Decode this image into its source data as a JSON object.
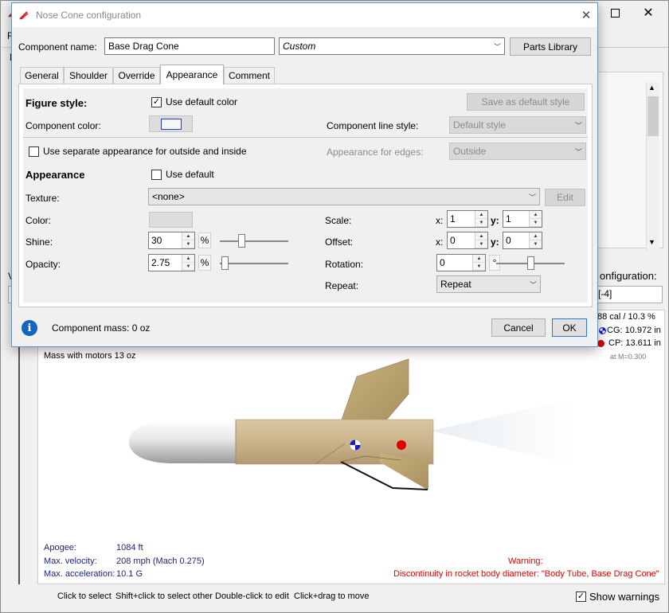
{
  "background": {
    "config_label_partial": "onfiguration:",
    "config_value_partial": "[-4]",
    "left_label_partial": "V",
    "side_tab_partial": "F",
    "menu_partial": "F",
    "stats": {
      "stability": "88 cal / 10.3 %",
      "cg": "CG: 10.972 in",
      "cp": "CP: 13.611 in",
      "mach_note": "at M=0.300"
    },
    "mass_with_motors": "Mass with motors 13 oz",
    "flight": {
      "apogee_label": "Apogee:",
      "apogee_value": "1084 ft",
      "velocity_label": "Max. velocity:",
      "velocity_value": "208 mph  (Mach 0.275)",
      "accel_label": "Max. acceleration:",
      "accel_value": "10.1 G"
    },
    "warning_title": "Warning:",
    "warning_text": "Discontinuity in rocket body diameter:  \"Body Tube, Base Drag Cone\"",
    "hints": {
      "select": "Click to select",
      "shift": "Shift+click to select other",
      "double": "Double-click to edit",
      "drag": "Click+drag to move"
    },
    "show_warnings_label": "Show warnings",
    "show_warnings_checked": true
  },
  "dialog": {
    "title": "Nose Cone configuration",
    "component_name_label": "Component name:",
    "component_name_value": "Base Drag Cone",
    "preset_value": "Custom",
    "parts_library_label": "Parts Library",
    "tabs": [
      "General",
      "Shoulder",
      "Override",
      "Appearance",
      "Comment"
    ],
    "active_tab": "Appearance",
    "figure_style_label": "Figure style:",
    "use_default_color_label": "Use default color",
    "use_default_color_checked": true,
    "save_default_style_label": "Save as default style",
    "component_color_label": "Component color:",
    "component_color_value": "#f4f6fb",
    "component_line_style_label": "Component line style:",
    "line_style_value": "Default style",
    "separate_appearance_label": "Use separate appearance for outside and inside",
    "appearance_edges_label": "Appearance for edges:",
    "edges_value": "Outside",
    "appearance_label": "Appearance",
    "use_default_label": "Use default",
    "texture_label": "Texture:",
    "texture_value": "<none>",
    "edit_label": "Edit",
    "color_label": "Color:",
    "shine_label": "Shine:",
    "shine_value": "30",
    "shine_unit": "%",
    "shine_level": 0.3,
    "opacity_label": "Opacity:",
    "opacity_value": "2.75",
    "opacity_unit": "%",
    "opacity_level": 0.0275,
    "scale_label": "Scale:",
    "scale_x_label": "x:",
    "scale_x": "1",
    "scale_y_label": "y:",
    "scale_y": "1",
    "offset_label": "Offset:",
    "offset_x_label": "x:",
    "offset_x": "0",
    "offset_y_label": "y:",
    "offset_y": "0",
    "rotation_label": "Rotation:",
    "rotation_value": "0",
    "rotation_unit": "°",
    "rotation_level": 0.5,
    "repeat_label": "Repeat:",
    "repeat_value": "Repeat",
    "component_mass": "Component mass: 0 oz",
    "cancel_label": "Cancel",
    "ok_label": "OK"
  },
  "icons": {
    "app": "rocket-icon",
    "info": "info-icon",
    "close": "close-icon"
  },
  "colors": {
    "accent_navy": "#1a237e",
    "warning_red": "#e00000",
    "info_blue": "#1565c0"
  }
}
